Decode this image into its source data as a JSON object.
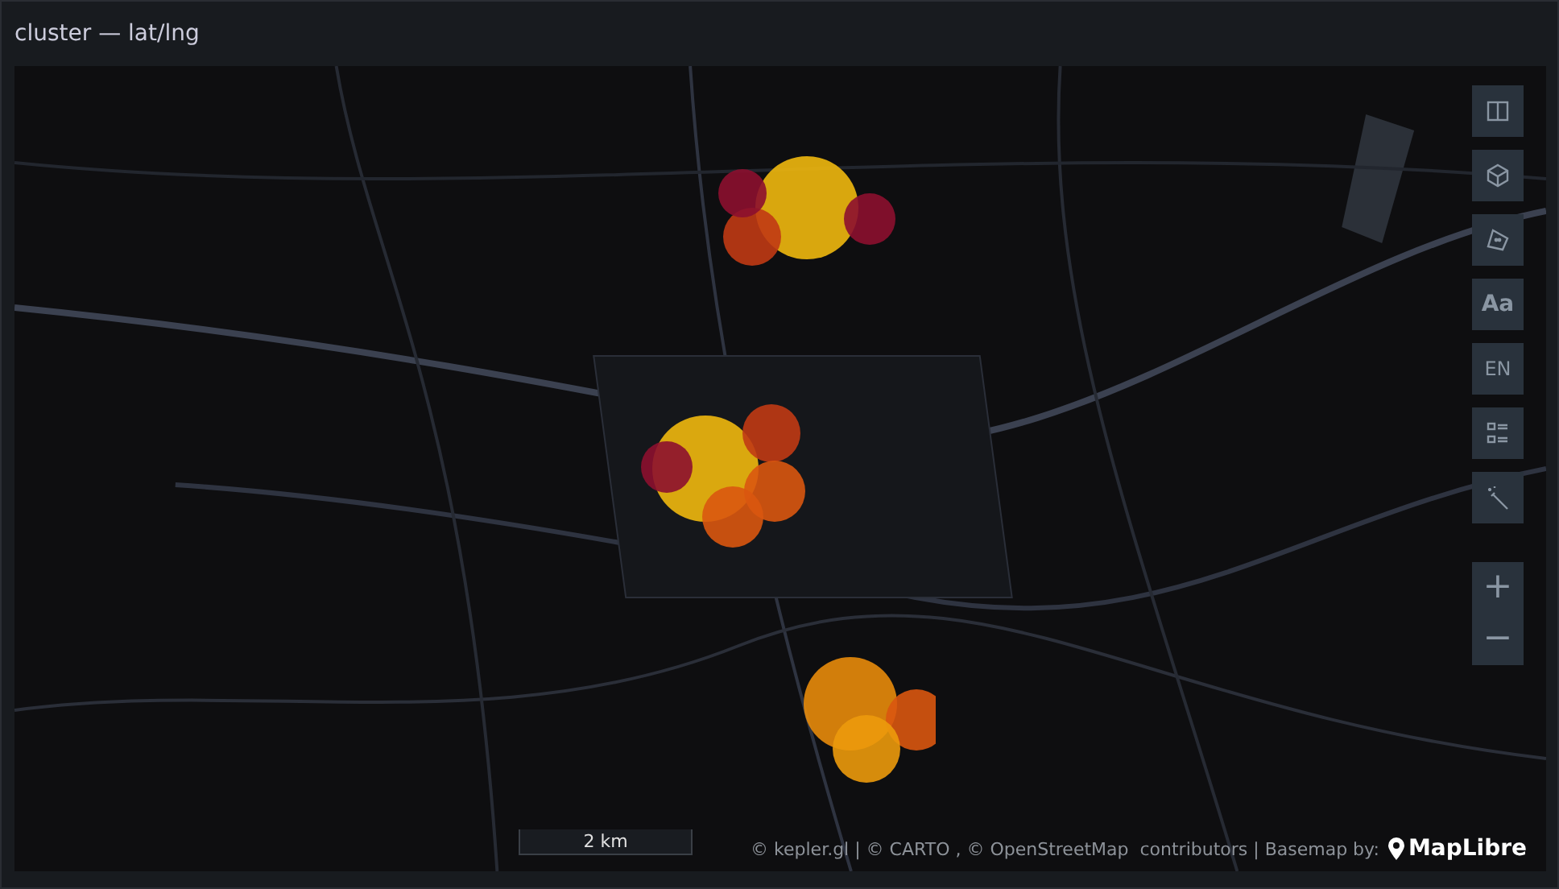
{
  "panel": {
    "title": "cluster — lat/lng"
  },
  "map": {
    "kind": "picture",
    "controls": [
      {
        "kind": "book"
      },
      {
        "kind": "cube"
      },
      {
        "kind": "polygon"
      },
      {
        "kind": "text",
        "label": "Aa"
      },
      {
        "kind": "text",
        "label": "EN"
      },
      {
        "kind": "legend"
      },
      {
        "kind": "wand"
      }
    ],
    "zoom": [
      "+",
      "−"
    ],
    "scale": "2 km",
    "attribution": "© kepler.gl | © CARTO , © OpenStreetMap  contributors | Basemap by:",
    "logo": "MapLibre"
  }
}
